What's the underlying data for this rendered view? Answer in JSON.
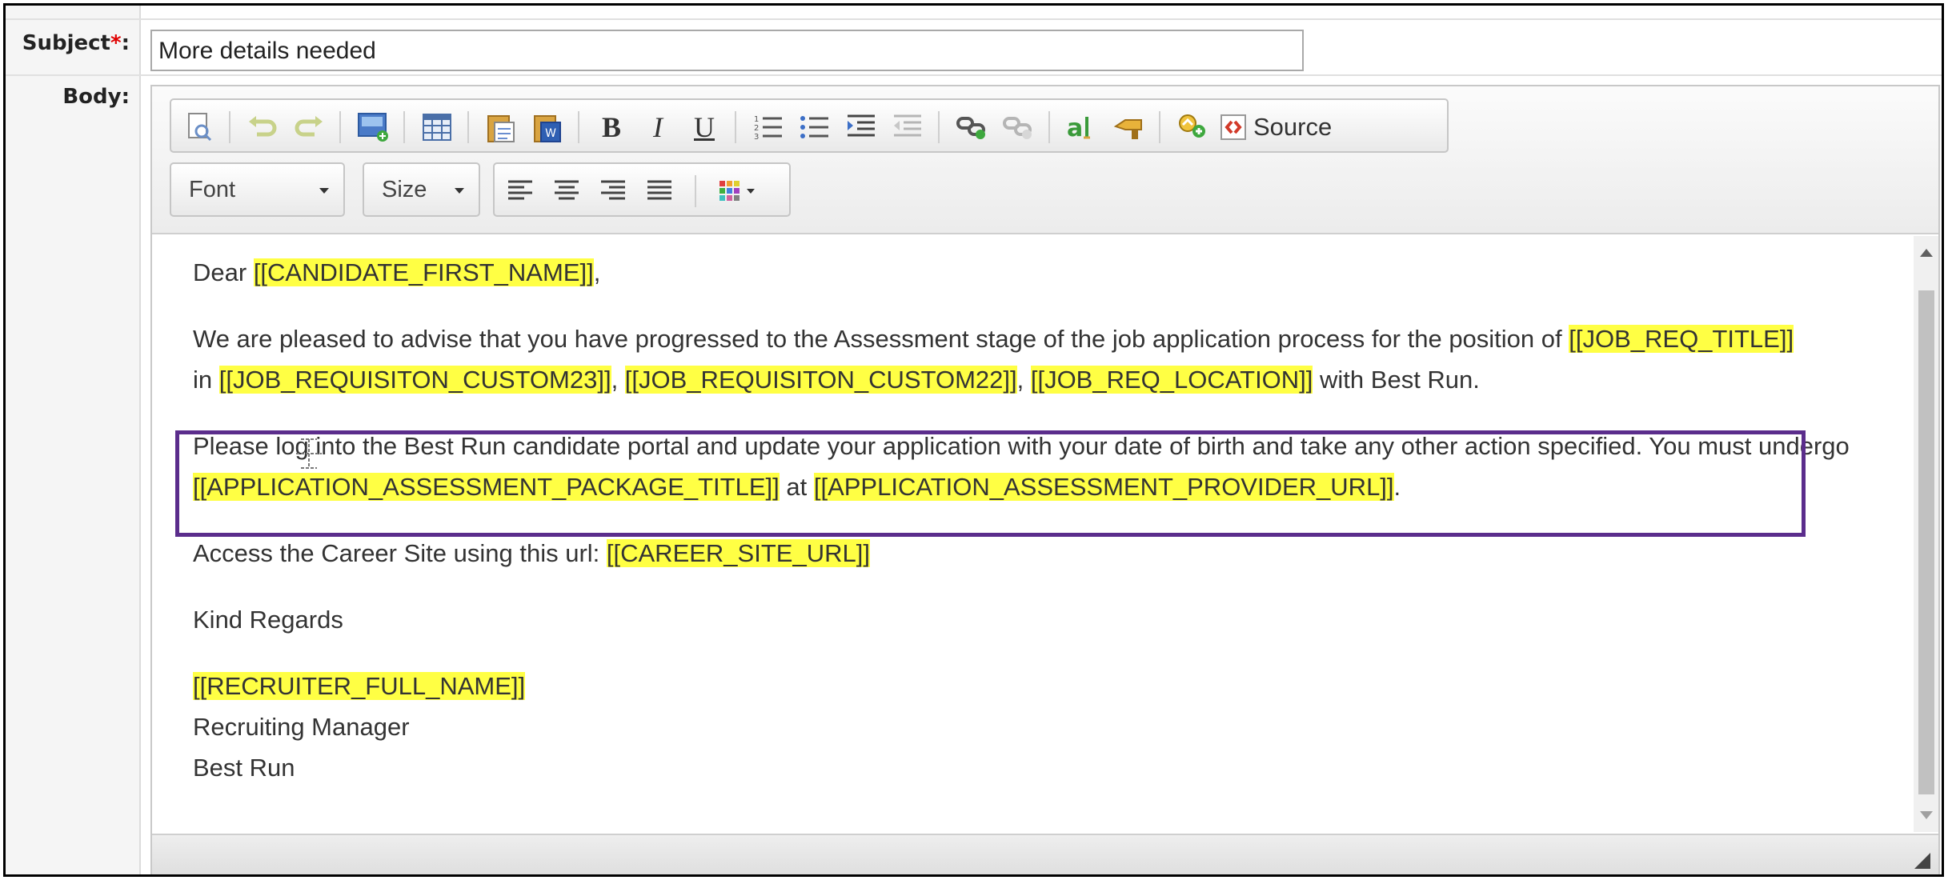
{
  "form": {
    "subject_label": "Subject",
    "required_marker": "*",
    "subject_colon": ":",
    "subject_value": "More details needed",
    "body_label": "Body:"
  },
  "toolbar": {
    "source_label": "Source",
    "font_combo": "Font",
    "size_combo": "Size",
    "bold": "B",
    "italic": "I",
    "underline": "U",
    "icons": [
      "preview-icon",
      "undo-icon",
      "redo-icon",
      "insert-image-icon",
      "table-icon",
      "paste-text-icon",
      "paste-word-icon",
      "bold-icon",
      "italic-icon",
      "underline-icon",
      "numbered-list-icon",
      "bulleted-list-icon",
      "indent-icon",
      "outdent-icon",
      "link-icon",
      "unlink-icon",
      "spellcheck-icon",
      "anchor-icon",
      "insert-token-icon",
      "source-icon",
      "align-left-icon",
      "align-center-icon",
      "align-right-icon",
      "justify-icon",
      "text-color-icon"
    ]
  },
  "body": {
    "p1": {
      "text": "Dear ",
      "token": "[[CANDIDATE_FIRST_NAME]]",
      "end": ","
    },
    "p2": {
      "t1": "We are pleased to advise that you have progressed to the Assessment stage of the job application process for the position of ",
      "tok1": "[[JOB_REQ_TITLE]]",
      "t2": " in ",
      "tok2": "[[JOB_REQUISITON_CUSTOM23]]",
      "t3": ", ",
      "tok3": "[[JOB_REQUISITON_CUSTOM22]]",
      "t4": ", ",
      "tok4": "[[JOB_REQ_LOCATION]]",
      "t5": " with Best Run."
    },
    "p3": {
      "t1": "Please log into the Best Run candidate portal and update your application with your date of birth and take any other action specified. You must undergo ",
      "tok1": "[[APPLICATION_ASSESSMENT_PACKAGE_TITLE]]",
      "t2": " at ",
      "tok2": "[[APPLICATION_ASSESSMENT_PROVIDER_URL]]",
      "t3": "."
    },
    "p4": {
      "text": "Access the Career Site using this url: ",
      "token": "[[CAREER_SITE_URL]]"
    },
    "p5": {
      "text": "Kind Regards"
    },
    "signature": {
      "token": "[[RECRUITER_FULL_NAME]]",
      "title": "Recruiting Manager",
      "company": "Best Run"
    }
  },
  "annotation": {
    "color": "#5b2d8c"
  },
  "colors": {
    "token_highlight": "#ffff44",
    "required": "#e00000"
  }
}
